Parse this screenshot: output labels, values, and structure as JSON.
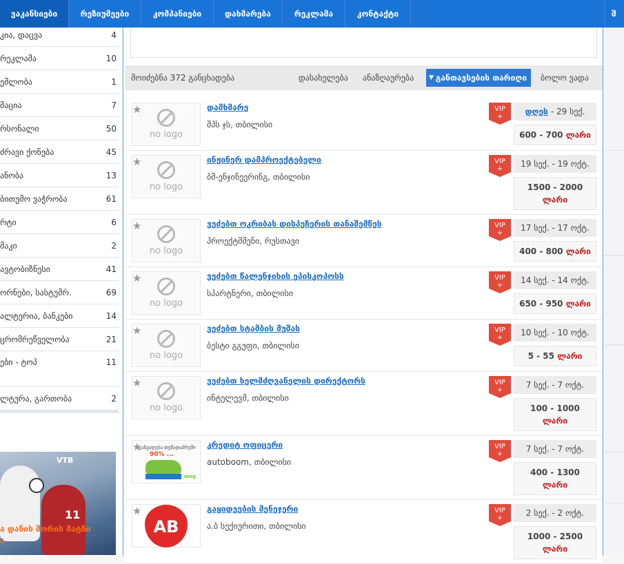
{
  "nav": {
    "tabs": [
      {
        "label": "ვაკანსიები"
      },
      {
        "label": "რეზიუმეები"
      },
      {
        "label": "კომპანიები"
      },
      {
        "label": "დახმარება"
      },
      {
        "label": "რეკლამა"
      },
      {
        "label": "კონტაქტი"
      }
    ],
    "edge_label": "შ"
  },
  "sidebar": {
    "items": [
      {
        "label": "კია, დაცვა",
        "count": "4"
      },
      {
        "label": "რეკლამა",
        "count": "10"
      },
      {
        "label": "ემლობა",
        "count": "1"
      },
      {
        "label": "მაცია",
        "count": "7"
      },
      {
        "label": "რსონალი",
        "count": "50"
      },
      {
        "label": "ძრავი ქონება",
        "count": "45"
      },
      {
        "label": "ანობა",
        "count": "13"
      },
      {
        "label": "ბითუმო ვაჭრობა",
        "count": "61"
      },
      {
        "label": "რტი",
        "count": "6"
      },
      {
        "label": "მაკი",
        "count": "2"
      },
      {
        "label": "ავტობიზნესი",
        "count": "41"
      },
      {
        "label": "ორნები, სასტუმრ.",
        "count": "69"
      },
      {
        "label": "ალტერია, ბანკები",
        "count": "14"
      },
      {
        "label": "ცრომრეწველობა",
        "count": "21"
      },
      {
        "label": "ები - ტოპ",
        "count": "11"
      },
      {
        "label": "ლტურა, გართობა",
        "count": "2"
      }
    ],
    "banner": {
      "brand": "VTB",
      "shirt_number": "11",
      "caption": "ა დანის შორის მატჩი\nა"
    }
  },
  "results": {
    "count_text": "მოიძებნა 372 განცხადება",
    "sort": {
      "location": "დასახელება",
      "name": "ანაზღაურება",
      "posted": "განთავსების თარიღი",
      "deadline": "ბოლო ვადა"
    }
  },
  "jobs": [
    {
      "title": "დამხმარე",
      "company": "შპს ჯს, თბილისი",
      "vip": "VIP",
      "date_prefix": "დღეს",
      "date": "- 29 სექ.",
      "salary_range": "600 - 700",
      "currency": "ლარი",
      "logo": "no logo"
    },
    {
      "title": "ინჟინერ დამპროექტებელი",
      "company": "ბმ-ენჯინეერინგ, თბილისი",
      "vip": "VIP",
      "date_prefix": "",
      "date": "19 სექ. - 19 ოქტ.",
      "salary_range": "1500 - 2000",
      "currency": "ლარი",
      "logo": "no logo"
    },
    {
      "title": "ვეძებთ ოკრიბას დისპეჩერის თანაშემწეს",
      "company": "პროექტმშენი, რუსთავი",
      "vip": "VIP",
      "date_prefix": "",
      "date": "17 სექ. - 17 ოქტ.",
      "salary_range": "400 - 800",
      "currency": "ლარი",
      "logo": "no logo"
    },
    {
      "title": "ვეძებთ წალენჯიხის ეპისკოპოსს",
      "company": "სპარტნერი, თბილისი",
      "vip": "VIP",
      "date_prefix": "",
      "date": "14 სექ. - 14 ოქტ.",
      "salary_range": "650 - 950",
      "currency": "ლარი",
      "logo": "no logo"
    },
    {
      "title": "ვეძებთ სტამბის მუშას",
      "company": "ბესტი გგუფი, თბილისი",
      "vip": "VIP",
      "date_prefix": "",
      "date": "10 სექ. - 10 ოქტ.",
      "salary_range": "5 - 55",
      "currency": "ლარი",
      "logo": "no logo"
    },
    {
      "title": "ვეძებთ ხელმძღვანელის დირექტორს",
      "company": "ინტელევმ, თბილისი",
      "vip": "VIP",
      "date_prefix": "",
      "date": "7 სექ. - 7 ოქტ.",
      "salary_range": "100 - 1000",
      "currency": "ლარი",
      "logo": "no logo"
    },
    {
      "title": "კრედიტ ოფიცერი",
      "company": "autoboom, თბილისი",
      "vip": "VIP",
      "date_prefix": "",
      "date": "7 სექ. - 7 ოქტ.",
      "salary_range": "400 - 1300",
      "currency": "ლარი",
      "logo": "credit",
      "logo_text_top": "განვადება თემადაპრეში",
      "logo_text_pct": "90% ...",
      "logo_text_brand": "mog"
    },
    {
      "title": "გაყიდვების მენეჯერი",
      "company": "ა.ბ სექიურითი, თბილისი",
      "vip": "VIP",
      "date_prefix": "",
      "date": "2 სექ. - 2 ოქტ.",
      "salary_range": "1000 - 2500",
      "currency": "ლარი",
      "logo": "ab",
      "logo_text": "AB"
    }
  ],
  "colors": {
    "nav": "#1a73d6",
    "link": "#1a6bc4",
    "vip": "#e24a3b",
    "currency": "#c81e1e"
  }
}
